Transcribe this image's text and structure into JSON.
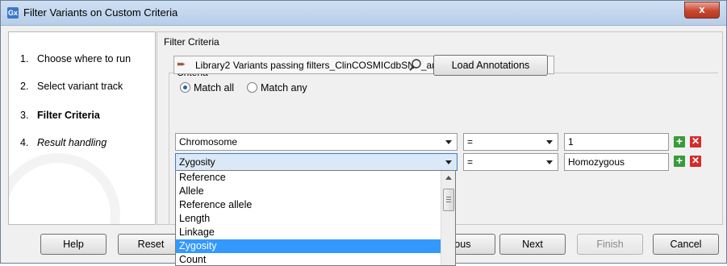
{
  "window": {
    "title": "Filter Variants on Custom Criteria",
    "app_icon_text": "Gx",
    "close_label": "x"
  },
  "steps": [
    {
      "num": "1.",
      "label": "Choose where to run",
      "style": "normal"
    },
    {
      "num": "2.",
      "label": "Select variant track",
      "style": "normal"
    },
    {
      "num": "3.",
      "label": "Filter Criteria",
      "style": "bold"
    },
    {
      "num": "4.",
      "label": "Result handling",
      "style": "italic"
    }
  ],
  "panel": {
    "title": "Filter Criteria",
    "criteria_label": "Criteria",
    "track_name": "Library2 Variants passing filters_ClinCOSMICdbSNP_annotated",
    "load_button": "Load Annotations",
    "match_all_label": "Match all",
    "match_any_label": "Match any",
    "match_selected": "all"
  },
  "rows": [
    {
      "field": "Chromosome",
      "operator": "=",
      "value": "1"
    },
    {
      "field": "Zygosity",
      "operator": "=",
      "value": "Homozygous"
    }
  ],
  "dropdown": {
    "options": [
      "Reference",
      "Allele",
      "Reference allele",
      "Length",
      "Linkage",
      "Zygosity",
      "Count"
    ],
    "selected": "Zygosity"
  },
  "buttons": {
    "help": "Help",
    "reset": "Reset",
    "previous_partial": "ious",
    "next": "Next",
    "finish": "Finish",
    "cancel": "Cancel"
  },
  "icons": {
    "plus": "+",
    "remove": "✕",
    "track": "▸▸▸"
  }
}
